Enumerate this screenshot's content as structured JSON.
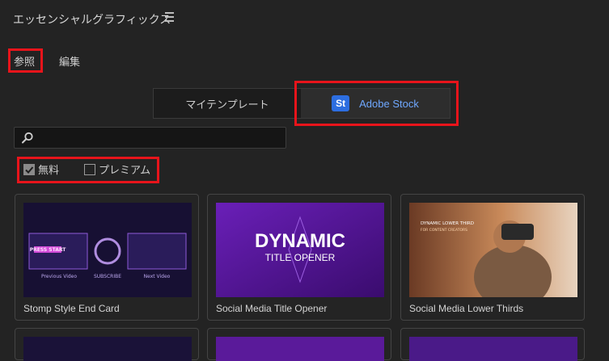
{
  "panel": {
    "title": "エッセンシャルグラフィックス",
    "menu_icon": "hamburger-icon"
  },
  "tabs": [
    {
      "label": "参照",
      "active": true
    },
    {
      "label": "編集",
      "active": false
    }
  ],
  "segmented": {
    "my_templates": "マイテンプレート",
    "adobe_stock": "Adobe Stock",
    "stock_badge": "St",
    "selected": "Adobe Stock"
  },
  "search": {
    "value": "",
    "icon": "search-icon"
  },
  "filters": [
    {
      "label": "無料",
      "checked": true
    },
    {
      "label": "プレミアム",
      "checked": false
    }
  ],
  "cards": [
    {
      "title": "Stomp Style End Card",
      "thumb": {
        "text_left": "Previous Video",
        "text_center": "SUBSCRIBE",
        "text_right": "Next Video",
        "banner": "PRESS START"
      }
    },
    {
      "title": "Social Media Title Opener",
      "thumb": {
        "headline": "DYNAMIC",
        "subheadline": "TITLE OPENER"
      }
    },
    {
      "title": "Social Media Lower Thirds",
      "thumb": {
        "headline": "DYNAMIC LOWER THIRD",
        "subheadline": "FOR CONTENT CREATORS"
      }
    }
  ],
  "colors": {
    "accent": "#e8141b",
    "stock_blue": "#6fa8ff",
    "background": "#232323"
  }
}
